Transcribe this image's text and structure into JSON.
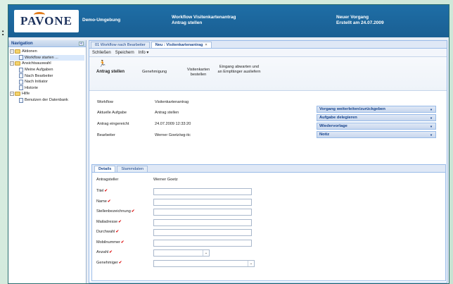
{
  "header": {
    "logo": "PAVONE",
    "environment": "Demo-Umgebung",
    "workflow_title_1": "Workflow Visitenkartenantrag",
    "workflow_title_2": "Antrag stellen",
    "status_1": "Neuer Vorgang",
    "status_2": "Erstellt am 24.07.2009"
  },
  "colon_marker": ":",
  "navigation": {
    "title": "Navigation",
    "collapse": "«",
    "items": [
      {
        "label": "Aktionen",
        "type": "folder",
        "level": 0,
        "twist": "−"
      },
      {
        "label": "Workflow starten ...",
        "type": "page",
        "level": 1
      },
      {
        "label": "Ansichtsauswahl",
        "type": "folder",
        "level": 0,
        "twist": "−"
      },
      {
        "label": "Meine Aufgaben",
        "type": "page",
        "level": 1
      },
      {
        "label": "Nach Bearbeiter",
        "type": "page",
        "level": 1
      },
      {
        "label": "Nach Initiator",
        "type": "page",
        "level": 1
      },
      {
        "label": "Historie",
        "type": "page",
        "level": 1
      },
      {
        "label": "Hilfe",
        "type": "folder",
        "level": 0,
        "twist": "−"
      },
      {
        "label": "Benutzen der Datenbank",
        "type": "page",
        "level": 1
      }
    ]
  },
  "tabs": [
    {
      "label": "01 Workflow nach Bearbeiter",
      "active": false
    },
    {
      "label": "Neu : Visitenkartenantrag",
      "active": true,
      "close": "×"
    }
  ],
  "toolbar": {
    "close": "Schließen",
    "save": "Speichern",
    "info": "Info ▾"
  },
  "steps": [
    {
      "label": "Antrag stellen",
      "active": true
    },
    {
      "label": "Genehmigung",
      "active": false
    },
    {
      "label": "Visitenkarten bestellen",
      "active": false
    },
    {
      "label": "Eingang abwarten und an Empfänger ausliefern",
      "active": false
    }
  ],
  "runner_icon": "🏃",
  "info": {
    "workflow_label": "Workflow",
    "workflow_value": "Visitenkartenantrag",
    "task_label": "Aktuelle Aufgabe",
    "task_value": "Antrag stellen",
    "received_label": "Antrag eingereicht",
    "received_value": "24.07.2009 12:33:20",
    "editor_label": "Bearbeiter",
    "editor_value": "Werner Goetz/wg-itc"
  },
  "panels": [
    {
      "label": "Vorgang weiterleiten/zurückgeben",
      "arrow": "▾"
    },
    {
      "label": "Aufgabe delegieren",
      "arrow": "▾"
    },
    {
      "label": "Wiedervorlage",
      "arrow": "▾"
    },
    {
      "label": "Notiz",
      "arrow": "▾"
    }
  ],
  "form_tabs": [
    {
      "label": "Details",
      "active": true
    },
    {
      "label": "Stammdaten",
      "active": false
    }
  ],
  "form": {
    "requester_label": "Antragsteller",
    "requester_value": "Werner Goetz",
    "required_mark": "✔",
    "fields": [
      {
        "label": "Titel",
        "value": ""
      },
      {
        "label": "Name",
        "value": ""
      },
      {
        "label": "Stellenbezeichnung",
        "value": ""
      },
      {
        "label": "Mailadresse",
        "value": ""
      },
      {
        "label": "Durchwahl",
        "value": ""
      },
      {
        "label": "Mobilnummer",
        "value": ""
      }
    ],
    "count_label": "Anzahl",
    "count_value": "",
    "approver_label": "Genehmiger",
    "approver_value": "",
    "dropdown_arrow": "⌄"
  }
}
